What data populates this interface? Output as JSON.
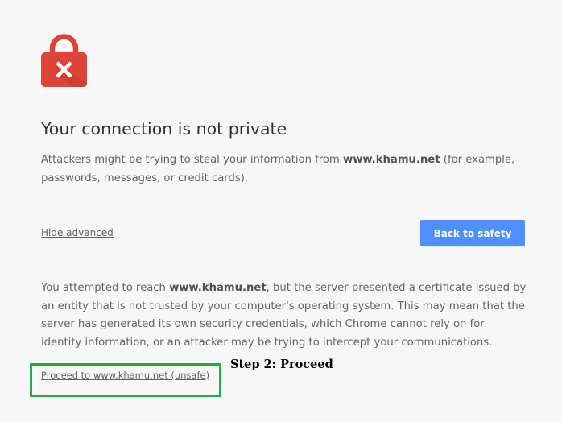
{
  "icon": {
    "name": "lock-error-icon",
    "color": "#db4437",
    "shadow_color": "#c23a2e",
    "mark_color": "#ffffff"
  },
  "interstitial": {
    "title": "Your connection is not private",
    "intro": {
      "before": "Attackers might be trying to steal your information from ",
      "domain": "www.khamu.net",
      "after": " (for example, passwords, messages, or credit cards)."
    },
    "hide_advanced": "Hide advanced",
    "back_button": "Back to safety",
    "details": {
      "before": "You attempted to reach ",
      "domain": "www.khamu.net",
      "after": ", but the server presented a certificate issued by an entity that is not trusted by your computer's operating system. This may mean that the server has generated its own security credentials, which Chrome cannot rely on for identity information, or an attacker may be trying to intercept your communications."
    },
    "proceed_link": "Proceed to www.khamu.net (unsafe)"
  },
  "annotation": {
    "step_label": "Step 2: Proceed",
    "highlight_color": "#23a84a"
  },
  "colors": {
    "background": "#f7f7f7",
    "accent_button": "#4d90fe",
    "body_text": "#646464",
    "title_text": "#333333"
  }
}
